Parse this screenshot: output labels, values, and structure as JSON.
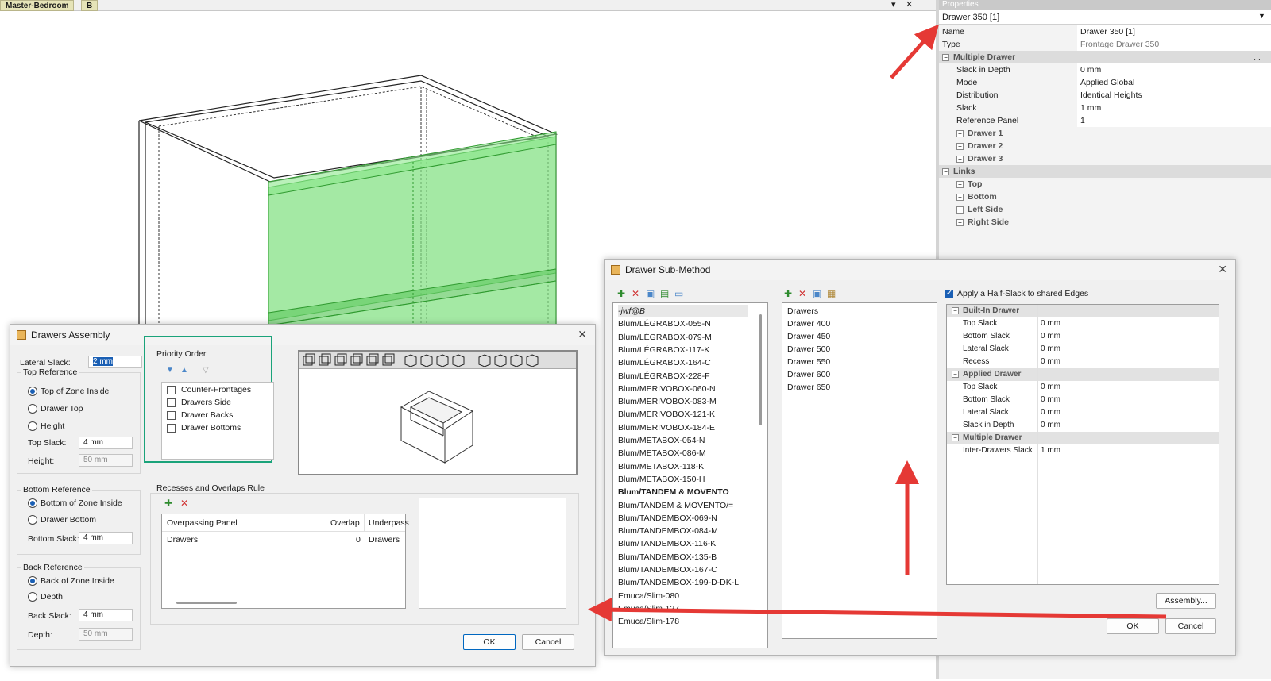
{
  "top_tabs": {
    "tab1": "Master-Bedroom",
    "tab2": "B",
    "pin": "▾",
    "close": "✕"
  },
  "properties": {
    "title": "Properties",
    "selected": "Drawer 350 [1]",
    "rows": [
      {
        "k": "Name",
        "v": "Drawer 350 [1]"
      },
      {
        "k": "Type",
        "v": "Frontage Drawer 350"
      },
      {
        "k": "Multiple Drawer",
        "v": ""
      },
      {
        "k": "Slack in Depth",
        "v": "0 mm"
      },
      {
        "k": "Mode",
        "v": "Applied Global"
      },
      {
        "k": "Distribution",
        "v": "Identical Heights"
      },
      {
        "k": "Slack",
        "v": "1 mm"
      },
      {
        "k": "Reference Panel",
        "v": "1"
      },
      {
        "k": "Drawer 1",
        "v": ""
      },
      {
        "k": "Drawer 2",
        "v": ""
      },
      {
        "k": "Drawer 3",
        "v": ""
      },
      {
        "k": "Links",
        "v": ""
      },
      {
        "k": "Top",
        "v": ""
      },
      {
        "k": "Bottom",
        "v": ""
      },
      {
        "k": "Left Side",
        "v": ""
      },
      {
        "k": "Right Side",
        "v": ""
      }
    ]
  },
  "drawers_assembly": {
    "title": "Drawers Assembly",
    "lateral_slack_label": "Lateral Slack:",
    "lateral_slack_value": "2 mm",
    "top_ref": {
      "title": "Top Reference",
      "options": [
        "Top of Zone Inside",
        "Drawer Top",
        "Height"
      ],
      "top_slack_label": "Top Slack:",
      "top_slack_value": "4 mm",
      "height_label": "Height:",
      "height_value": "50 mm"
    },
    "bottom_ref": {
      "title": "Bottom Reference",
      "options": [
        "Bottom of Zone Inside",
        "Drawer Bottom"
      ],
      "slack_label": "Bottom Slack:",
      "slack_value": "4 mm"
    },
    "back_ref": {
      "title": "Back Reference",
      "options": [
        "Back of Zone Inside",
        "Depth"
      ],
      "slack_label": "Back Slack:",
      "slack_value": "4 mm",
      "depth_label": "Depth:",
      "depth_value": "50 mm"
    },
    "priority": {
      "title": "Priority Order",
      "items": [
        "Counter-Frontages",
        "Drawers Side",
        "Drawer Backs",
        "Drawer Bottoms"
      ]
    },
    "recesses": {
      "title": "Recesses and Overlaps Rule",
      "columns": [
        "Overpassing Panel",
        "Overlap",
        "Underpass"
      ],
      "row": [
        "Drawers",
        "0",
        "Drawers"
      ]
    },
    "ok": "OK",
    "cancel": "Cancel"
  },
  "sub_method": {
    "title": "Drawer Sub-Method",
    "methods": [
      "-jwf@B",
      "Blum/LÉGRABOX-055-N",
      "Blum/LÉGRABOX-079-M",
      "Blum/LÉGRABOX-117-K",
      "Blum/LÉGRABOX-164-C",
      "Blum/LÉGRABOX-228-F",
      "Blum/MERIVOBOX-060-N",
      "Blum/MERIVOBOX-083-M",
      "Blum/MERIVOBOX-121-K",
      "Blum/MERIVOBOX-184-E",
      "Blum/METABOX-054-N",
      "Blum/METABOX-086-M",
      "Blum/METABOX-118-K",
      "Blum/METABOX-150-H",
      "Blum/TANDEM & MOVENTO",
      "Blum/TANDEM & MOVENTO/=",
      "Blum/TANDEMBOX-069-N",
      "Blum/TANDEMBOX-084-M",
      "Blum/TANDEMBOX-116-K",
      "Blum/TANDEMBOX-135-B",
      "Blum/TANDEMBOX-167-C",
      "Blum/TANDEMBOX-199-D-DK-L",
      "Emuca/Slim-080",
      "Emuca/Slim-127",
      "Emuca/Slim-178"
    ],
    "drawers": [
      "Drawers",
      "Drawer 400",
      "Drawer 450",
      "Drawer 500",
      "Drawer 550",
      "Drawer 600",
      "Drawer 650"
    ],
    "half_slack": "Apply a Half-Slack to shared Edges",
    "grid": [
      {
        "k": "Built-In Drawer",
        "v": "",
        "cat": true
      },
      {
        "k": "Top Slack",
        "v": "0 mm"
      },
      {
        "k": "Bottom Slack",
        "v": "0 mm"
      },
      {
        "k": "Lateral Slack",
        "v": "0 mm"
      },
      {
        "k": "Recess",
        "v": "0 mm"
      },
      {
        "k": "Applied Drawer",
        "v": "",
        "cat": true
      },
      {
        "k": "Top Slack",
        "v": "0 mm"
      },
      {
        "k": "Bottom Slack",
        "v": "0 mm"
      },
      {
        "k": "Lateral Slack",
        "v": "0 mm"
      },
      {
        "k": "Slack in Depth",
        "v": "0 mm"
      },
      {
        "k": "Multiple Drawer",
        "v": "",
        "cat": true
      },
      {
        "k": "Inter-Drawers Slack",
        "v": "1 mm"
      }
    ],
    "assembly": "Assembly...",
    "ok": "OK",
    "cancel": "Cancel"
  },
  "colors": {
    "accent": "#1a5fb4",
    "highlight_green": "#7ee07e",
    "annotation_red": "#e53935",
    "frame_teal": "#1aa37a"
  }
}
